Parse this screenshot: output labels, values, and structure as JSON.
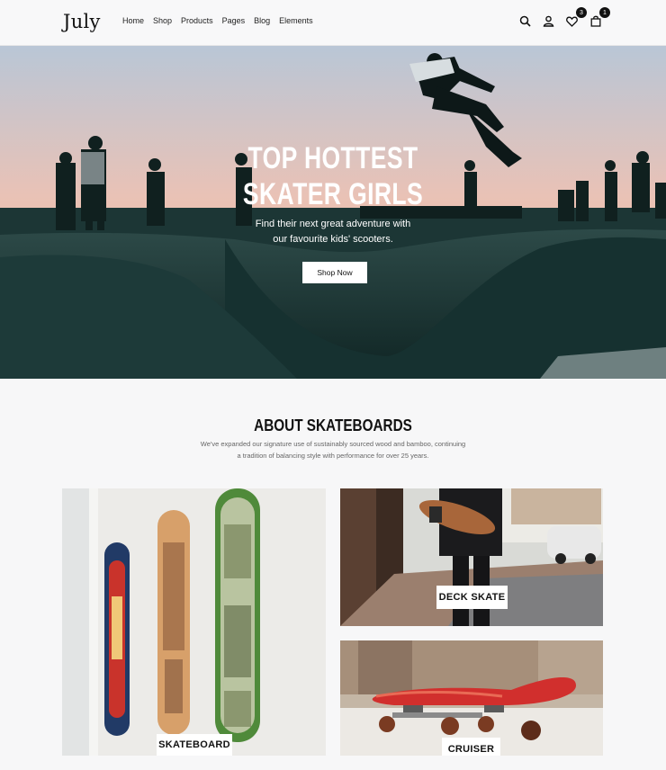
{
  "header": {
    "logo": "July",
    "nav": [
      "Home",
      "Shop",
      "Products",
      "Pages",
      "Blog",
      "Elements"
    ],
    "icons": [
      "search-icon",
      "account-icon",
      "wishlist-icon",
      "cart-icon"
    ],
    "wishlist_count": "3",
    "cart_count": "1"
  },
  "hero": {
    "title_line1": "TOP HOTTEST",
    "title_line2": "SKATER GIRLS",
    "subtitle_line1": "Find their next great adventure with",
    "subtitle_line2": "our favourite kids' scooters.",
    "button": "Shop Now"
  },
  "about": {
    "title": "ABOUT SKATEBOARDS",
    "text_line1": "We've expanded our signature use of sustainably sourced wood and bamboo, continuing",
    "text_line2": "a tradition of balancing style with performance for over 25 years."
  },
  "categories": [
    {
      "label": "SKATEBOARD"
    },
    {
      "label": "DECK SKATE"
    },
    {
      "label": "CRUISER"
    }
  ]
}
